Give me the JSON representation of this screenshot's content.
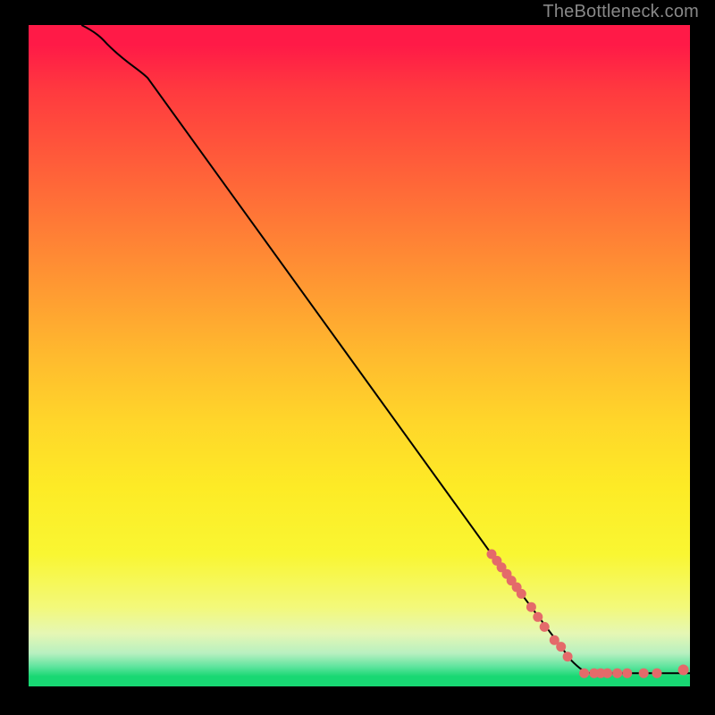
{
  "watermark": "TheBottleneck.com",
  "chart_data": {
    "type": "line",
    "title": "",
    "xlabel": "",
    "ylabel": "",
    "xlim": [
      0,
      100
    ],
    "ylim": [
      0,
      100
    ],
    "grid": false,
    "series": [
      {
        "name": "curve",
        "points": [
          {
            "x": 8,
            "y": 100
          },
          {
            "x": 12,
            "y": 97
          },
          {
            "x": 18,
            "y": 92
          },
          {
            "x": 70,
            "y": 20
          },
          {
            "x": 82,
            "y": 4
          },
          {
            "x": 85,
            "y": 2
          },
          {
            "x": 100,
            "y": 2
          }
        ]
      }
    ],
    "markers": [
      {
        "x": 70.0,
        "y": 20.0
      },
      {
        "x": 70.8,
        "y": 19.0
      },
      {
        "x": 71.5,
        "y": 18.0
      },
      {
        "x": 72.3,
        "y": 17.0
      },
      {
        "x": 73.0,
        "y": 16.0
      },
      {
        "x": 73.8,
        "y": 15.0
      },
      {
        "x": 74.5,
        "y": 14.0
      },
      {
        "x": 76.0,
        "y": 12.0
      },
      {
        "x": 77.0,
        "y": 10.5
      },
      {
        "x": 78.0,
        "y": 9.0
      },
      {
        "x": 79.5,
        "y": 7.0
      },
      {
        "x": 80.5,
        "y": 6.0
      },
      {
        "x": 81.5,
        "y": 4.5
      },
      {
        "x": 84.0,
        "y": 2.0
      },
      {
        "x": 85.5,
        "y": 2.0
      },
      {
        "x": 86.5,
        "y": 2.0
      },
      {
        "x": 87.5,
        "y": 2.0
      },
      {
        "x": 89.0,
        "y": 2.0
      },
      {
        "x": 90.5,
        "y": 2.0
      },
      {
        "x": 93.0,
        "y": 2.0
      },
      {
        "x": 95.0,
        "y": 2.0
      },
      {
        "x": 99.0,
        "y": 2.5
      }
    ],
    "background_gradient": {
      "top": "#ff1a47",
      "mid": "#ffd62a",
      "bottom": "#18d873"
    }
  }
}
